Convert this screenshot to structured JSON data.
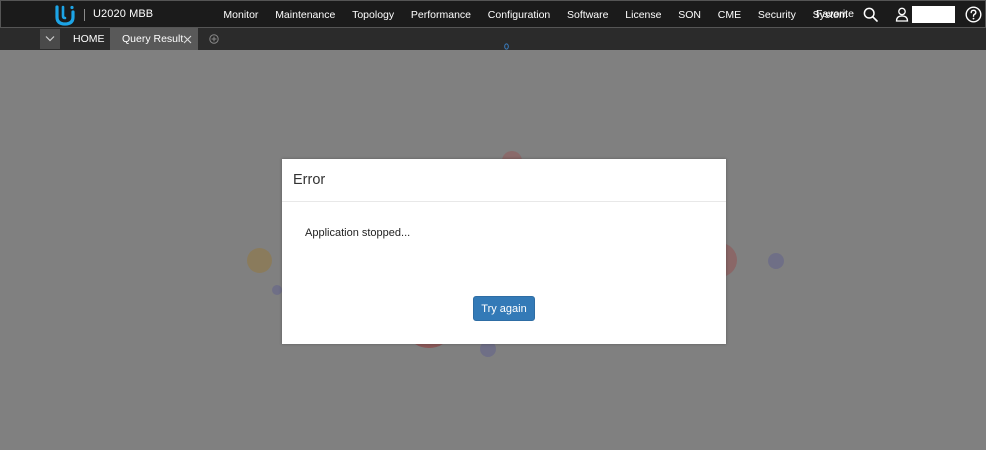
{
  "header": {
    "product_name": "U2020 MBB",
    "menu": [
      "Monitor",
      "Maintenance",
      "Topology",
      "Performance",
      "Configuration",
      "Software",
      "License",
      "SON",
      "CME",
      "Security",
      "System"
    ],
    "favorite_label": "Favorite",
    "icons": {
      "logo": "huawei-u-logo-icon",
      "search": "search-icon",
      "user": "user-icon",
      "help": "help-icon"
    }
  },
  "tabs": {
    "items": [
      {
        "label": "HOME",
        "active": false
      },
      {
        "label": "Query Result",
        "active": true
      }
    ],
    "icons": {
      "dropdown": "chevron-down-icon",
      "close": "close-icon",
      "add": "add-tab-icon"
    }
  },
  "dialog": {
    "title": "Error",
    "message": "Application stopped...",
    "button_label": "Try again"
  },
  "colors": {
    "topbar_bg": "#1b1b1b",
    "tabbar_bg": "#2b2b2b",
    "active_tab_bg": "#595959",
    "overlay_bg": "#808080",
    "primary_button": "#337ab7",
    "logo_blue": "#1ca4e6"
  }
}
